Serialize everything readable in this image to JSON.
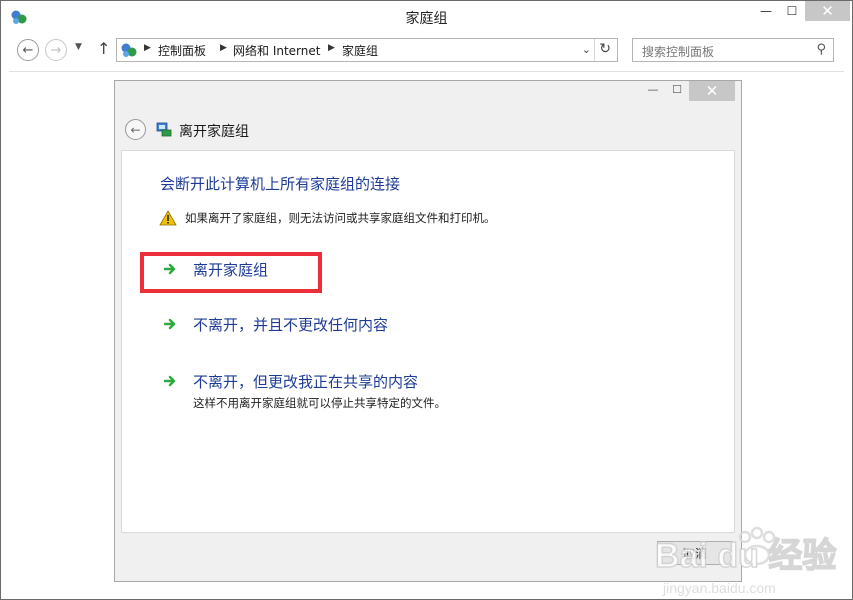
{
  "window": {
    "title": "家庭组",
    "controls": {
      "minimize": "—",
      "maximize": "☐",
      "close": "✕"
    }
  },
  "address_bar": {
    "crumbs": [
      "控制面板",
      "网络和 Internet",
      "家庭组"
    ],
    "refresh": "↻",
    "dropdown": "⌄"
  },
  "search": {
    "placeholder": "搜索控制面板",
    "icon": "⚲"
  },
  "nav": {
    "back": "←",
    "forward": "→",
    "up": "↑",
    "history": "▼"
  },
  "dialog": {
    "title": "离开家庭组",
    "headline": "会断开此计算机上所有家庭组的连接",
    "warning": "如果离开了家庭组，则无法访问或共享家庭组文件和打印机。",
    "options": [
      {
        "label": "离开家庭组"
      },
      {
        "label": "不离开，并且不更改任何内容"
      },
      {
        "label": "不离开，但更改我正在共享的内容",
        "sub": "这样不用离开家庭组就可以停止共享特定的文件。"
      }
    ],
    "cancel_label": "取消"
  },
  "watermark": {
    "brand": "Bai du 经验",
    "url": "jingyan.baidu.com"
  },
  "colors": {
    "link_blue": "#1e3c96",
    "highlight_red": "#ec2d3a",
    "close_btn_gray": "#c7c7c7",
    "arrow_green": "#2eab3c"
  },
  "icons": {
    "app": "homegroup-icon",
    "back": "back-arrow-icon",
    "warning": "warning-triangle-icon",
    "option_arrow": "green-arrow-icon",
    "search": "search-icon",
    "refresh": "refresh-icon"
  }
}
